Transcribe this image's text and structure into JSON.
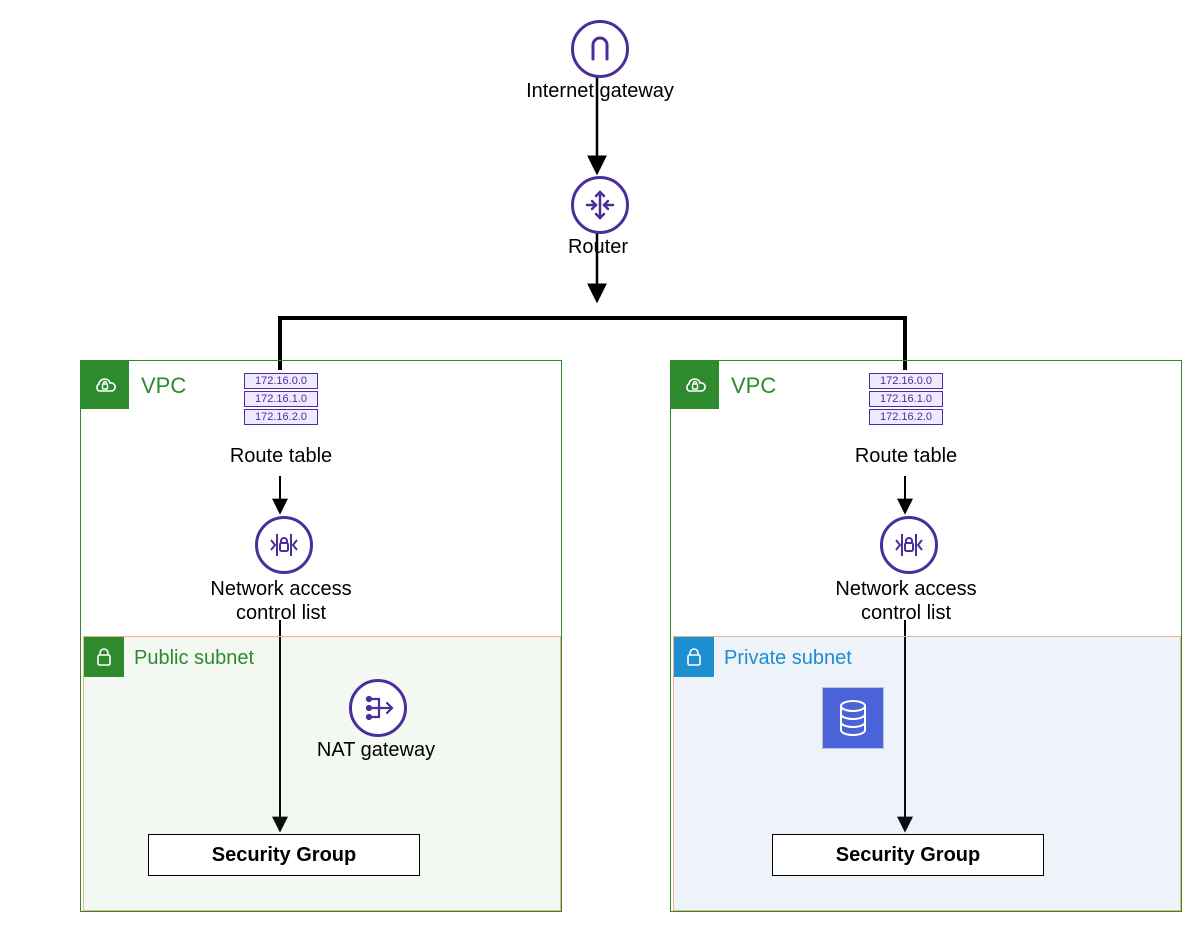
{
  "nodes": {
    "internet_gateway": {
      "label": "Internet gateway"
    },
    "router": {
      "label": "Router"
    },
    "route_table": {
      "label": "Route table",
      "rows": [
        "172.16.0.0",
        "172.16.1.0",
        "172.16.2.0"
      ]
    },
    "nacl": {
      "label": "Network access\ncontrol list"
    },
    "nat_gateway": {
      "label": "NAT gateway"
    },
    "security_group": {
      "label": "Security Group"
    }
  },
  "vpc_left": {
    "title": "VPC",
    "subnet": {
      "title": "Public subnet"
    }
  },
  "vpc_right": {
    "title": "VPC",
    "subnet": {
      "title": "Private subnet"
    }
  },
  "colors": {
    "purple": "#4b2e9b",
    "vpc_green": "#2d8a2d",
    "subnet_blue": "#1d8ecf",
    "db_blue": "#4b63d8"
  }
}
